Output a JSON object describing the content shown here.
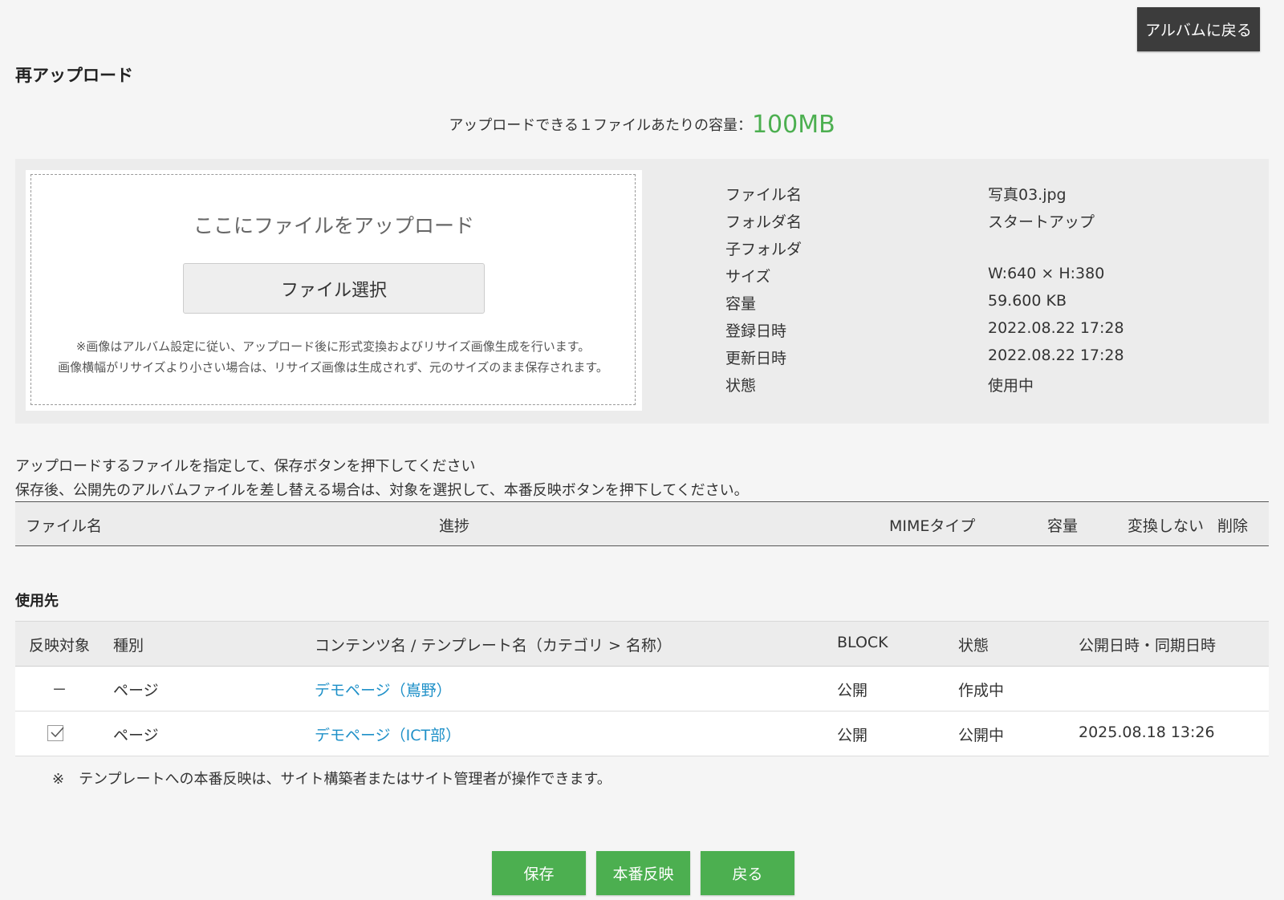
{
  "header": {
    "back_to_album": "アルバムに戻る",
    "title": "再アップロード"
  },
  "capacity": {
    "label": "アップロードできる１ファイルあたりの容量：",
    "value": "100MB"
  },
  "dropzone": {
    "text": "ここにファイルをアップロード",
    "select_button": "ファイル選択",
    "note_line1": "※画像はアルバム設定に従い、アップロード後に形式変換およびリサイズ画像生成を行います。",
    "note_line2": "画像横幅がリサイズより小さい場合は、リサイズ画像は生成されず、元のサイズのまま保存されます。"
  },
  "file_info": [
    {
      "key": "ファイル名",
      "value": "写真03.jpg"
    },
    {
      "key": "フォルダ名",
      "value": "スタートアップ"
    },
    {
      "key": "子フォルダ",
      "value": ""
    },
    {
      "key": "サイズ",
      "value": "W:640 × H:380"
    },
    {
      "key": "容量",
      "value": "59.600 KB"
    },
    {
      "key": "登録日時",
      "value": "2022.08.22 17:28"
    },
    {
      "key": "更新日時",
      "value": "2022.08.22 17:28"
    },
    {
      "key": "状態",
      "value": "使用中"
    }
  ],
  "instructions": {
    "line1": "アップロードするファイルを指定して、保存ボタンを押下してください",
    "line2": "保存後、公開先のアルバムファイルを差し替える場合は、対象を選択して、本番反映ボタンを押下してください。"
  },
  "file_table": {
    "columns": {
      "filename": "ファイル名",
      "progress": "進捗",
      "mime": "MIMEタイプ",
      "capacity": "容量",
      "no_convert": "変換しない",
      "delete": "削除"
    }
  },
  "usage": {
    "title": "使用先",
    "columns": {
      "target": "反映対象",
      "kind": "種別",
      "content": "コンテンツ名 / テンプレート名（カテゴリ > 名称）",
      "block": "BLOCK",
      "status": "状態",
      "published": "公開日時・同期日時"
    },
    "rows": [
      {
        "target": "－",
        "checked": false,
        "kind": "ページ",
        "content": "デモページ（嶌野）",
        "block": "公開",
        "status": "作成中",
        "published": ""
      },
      {
        "target": "",
        "checked": true,
        "kind": "ページ",
        "content": "デモページ（ICT部）",
        "block": "公開",
        "status": "公開中",
        "published": "2025.08.18 13:26"
      }
    ],
    "footnote": "※　テンプレートへの本番反映は、サイト構築者またはサイト管理者が操作できます。"
  },
  "actions": {
    "save": "保存",
    "publish": "本番反映",
    "back": "戻る"
  },
  "colors": {
    "accent_green": "#4caf50",
    "dark_button": "#3c3c3c",
    "link_blue": "#1e90c8"
  }
}
